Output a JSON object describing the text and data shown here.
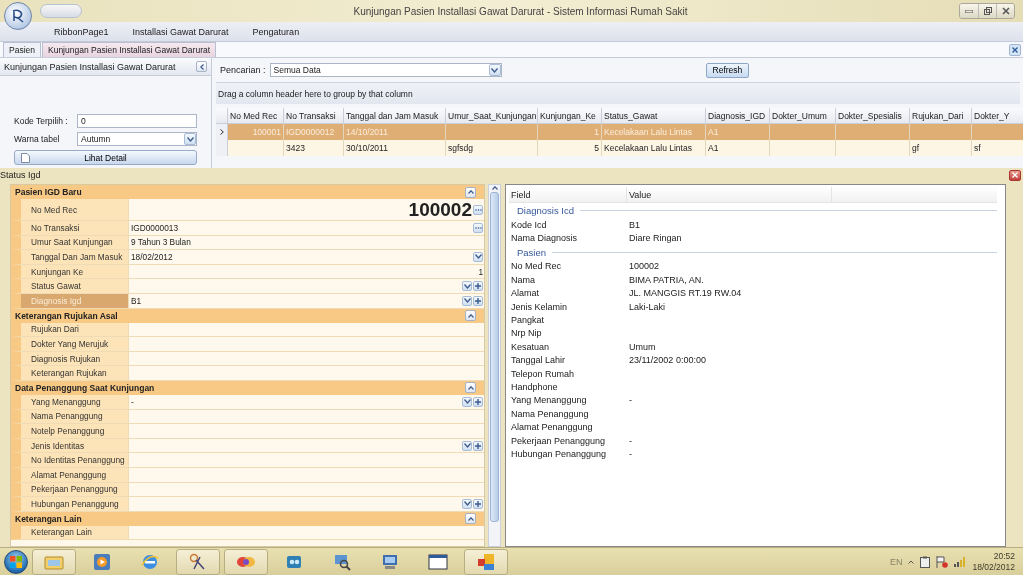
{
  "window": {
    "title": "Kunjungan Pasien Installasi Gawat Darurat - Sistem Informasi Rumah Sakit"
  },
  "ribbon_tabs": [
    {
      "label": "RibbonPage1"
    },
    {
      "label": "Installasi Gawat Darurat"
    },
    {
      "label": "Pengaturan"
    }
  ],
  "document_tabs": [
    {
      "label": "Pasien",
      "selected": false
    },
    {
      "label": "Kunjungan Pasien Installasi Gawat Darurat",
      "selected": true
    }
  ],
  "left_panel": {
    "title": "Kunjungan Pasien Installasi Gawat Darurat",
    "fields": [
      {
        "label": "Kode Terpilih :",
        "value": "0",
        "kind": "text"
      },
      {
        "label": "Warna tabel",
        "value": "Autumn",
        "kind": "dropdown"
      }
    ],
    "button": "Lihat Detail"
  },
  "search": {
    "label": "Pencarian :",
    "value": "Semua Data"
  },
  "refresh_button": "Refresh",
  "grid": {
    "group_hint": "Drag a column header here to group by that column",
    "columns": [
      "No Med Rec",
      "No Transaksi",
      "Tanggal dan Jam Masuk",
      "Umur_Saat_Kunjungan",
      "Kunjungan_Ke",
      "Status_Gawat",
      "Diagnosis_IGD",
      "Dokter_Umum",
      "Dokter_Spesialis",
      "Rujukan_Dari",
      "Dokter_Y"
    ],
    "rows": [
      {
        "selected": true,
        "cells": [
          "100001",
          "IGD0000012",
          "14/10/2011",
          "",
          "1",
          "Kecelakaan Lalu Lintas",
          "A1",
          "",
          "",
          "",
          ""
        ]
      },
      {
        "selected": false,
        "cells": [
          "",
          "3423",
          "30/10/2011",
          "sgfsdg",
          "5",
          "Kecelakaan Lalu Lintas",
          "A1",
          "",
          "",
          "gf",
          "sf"
        ]
      }
    ]
  },
  "dialog": {
    "title": "Status Igd",
    "categories": [
      {
        "title": "Pasien IGD Baru",
        "rows": [
          {
            "label": "No Med Rec",
            "value": "100002",
            "kind": "large",
            "has_ellipsis": true,
            "selected": false
          },
          {
            "label": "No Transaksi",
            "value": "IGD0000013",
            "kind": "text",
            "has_ellipsis": true,
            "selected": false
          },
          {
            "label": "Umur Saat Kunjungan",
            "value": "9 Tahun 3 Bulan",
            "kind": "text",
            "selected": false
          },
          {
            "label": "Tanggal Dan Jam Masuk",
            "value": "18/02/2012",
            "kind": "text",
            "has_dropdown": true,
            "selected": false
          },
          {
            "label": "Kunjungan Ke",
            "value": "1",
            "kind": "number",
            "selected": false
          },
          {
            "label": "Status Gawat",
            "kind": "text",
            "has_dropdown": true,
            "has_add": true,
            "selected": false
          },
          {
            "label": "Diagnosis Igd",
            "value": "B1",
            "kind": "text",
            "has_dropdown": true,
            "has_add": true,
            "selected": true
          }
        ]
      },
      {
        "title": "Keterangan Rujukan Asal",
        "rows": [
          {
            "label": "Rujukan Dari",
            "kind": "text",
            "selected": false
          },
          {
            "label": "Dokter Yang Merujuk",
            "kind": "text",
            "selected": false
          },
          {
            "label": "Diagnosis Rujukan",
            "kind": "text",
            "selected": false
          },
          {
            "label": "Keterangan Rujukan",
            "kind": "text",
            "selected": false
          }
        ]
      },
      {
        "title": "Data Penanggung Saat Kunjungan",
        "rows": [
          {
            "label": "Yang Menanggung",
            "value": "-",
            "kind": "text",
            "has_dropdown": true,
            "has_add": true,
            "selected": false
          },
          {
            "label": "Nama Penanggung",
            "kind": "text",
            "selected": false
          },
          {
            "label": "Notelp Penanggung",
            "kind": "text",
            "selected": false
          },
          {
            "label": "Jenis Identitas",
            "kind": "text",
            "has_dropdown": true,
            "has_add": true,
            "selected": false
          },
          {
            "label": "No Identitas Penanggung",
            "kind": "text",
            "selected": false
          },
          {
            "label": "Alamat Penanggung",
            "kind": "text",
            "selected": false
          },
          {
            "label": "Pekerjaan Penanggung",
            "kind": "text",
            "selected": false
          },
          {
            "label": "Hubungan Penanggung",
            "kind": "text",
            "has_dropdown": true,
            "has_add": true,
            "selected": false
          }
        ]
      },
      {
        "title": "Keterangan Lain",
        "rows": [
          {
            "label": "Keterangan Lain",
            "kind": "text",
            "selected": false
          }
        ]
      }
    ],
    "details": {
      "columns": [
        "Field",
        "Value"
      ],
      "groups": [
        {
          "title": "Diagnosis Icd",
          "items": [
            {
              "field": "Kode Icd",
              "value": "B1"
            },
            {
              "field": "Nama Diagnosis",
              "value": "Diare Ringan"
            }
          ]
        },
        {
          "title": "Pasien",
          "items": [
            {
              "field": "No Med Rec",
              "value": "100002"
            },
            {
              "field": "Nama",
              "value": "BIMA PATRIA, AN."
            },
            {
              "field": "Alamat",
              "value": "JL. MANGGIS RT.19 RW.04"
            },
            {
              "field": "Jenis Kelamin",
              "value": "Laki-Laki"
            },
            {
              "field": "Pangkat"
            },
            {
              "field": "Nrp Nip"
            },
            {
              "field": "Kesatuan",
              "value": "Umum"
            },
            {
              "field": "Tanggal Lahir",
              "value": "23/11/2002 0:00:00"
            },
            {
              "field": "Telepon Rumah"
            },
            {
              "field": "Handphone"
            },
            {
              "field": "Yang Menanggung",
              "value": "-"
            },
            {
              "field": "Nama Penanggung"
            },
            {
              "field": "Alamat Penanggung"
            },
            {
              "field": "Pekerjaan Penanggung",
              "value": "-"
            },
            {
              "field": "Hubungan Penanggung",
              "value": "-"
            }
          ]
        }
      ]
    }
  },
  "taskbar": {
    "language": "EN",
    "time": "20:52",
    "date": "18/02/2012"
  }
}
